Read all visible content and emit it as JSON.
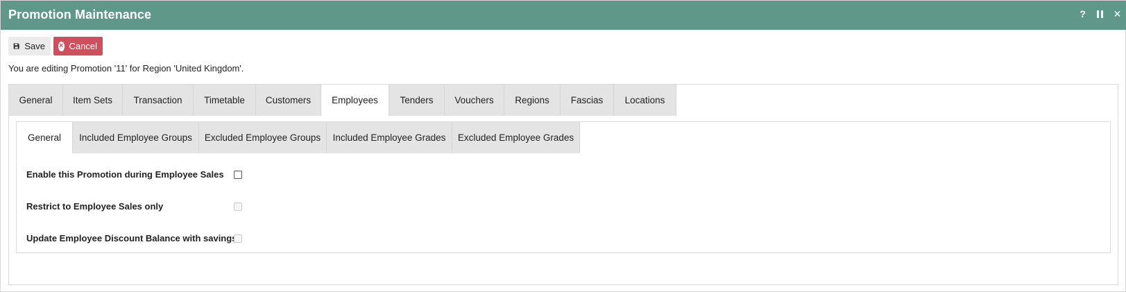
{
  "window": {
    "title": "Promotion Maintenance",
    "controls": {
      "help_label": "?",
      "close_label": "✕"
    }
  },
  "toolbar": {
    "save_label": "Save",
    "cancel_label": "Cancel"
  },
  "info_text": "You are editing Promotion '11' for Region 'United Kingdom'.",
  "main_tabs": [
    {
      "label": "General"
    },
    {
      "label": "Item Sets"
    },
    {
      "label": "Transaction"
    },
    {
      "label": "Timetable"
    },
    {
      "label": "Customers"
    },
    {
      "label": "Employees",
      "active": true
    },
    {
      "label": "Tenders"
    },
    {
      "label": "Vouchers"
    },
    {
      "label": "Regions"
    },
    {
      "label": "Fascias"
    },
    {
      "label": "Locations"
    }
  ],
  "sub_tabs": [
    {
      "label": "General",
      "active": true
    },
    {
      "label": "Included Employee Groups"
    },
    {
      "label": "Excluded Employee Groups"
    },
    {
      "label": "Included Employee Grades"
    },
    {
      "label": "Excluded Employee Grades"
    }
  ],
  "form": {
    "enable_label": "Enable this Promotion during Employee Sales",
    "enable_checked": false,
    "restrict_label": "Restrict to Employee Sales only",
    "restrict_checked": false,
    "update_label": "Update Employee Discount Balance with savings",
    "update_checked": false
  },
  "colors": {
    "titlebar": "#5f9888",
    "cancel_button": "#cf4f5d",
    "tab_inactive": "#e4e4e4",
    "tab_active": "#ffffff"
  }
}
